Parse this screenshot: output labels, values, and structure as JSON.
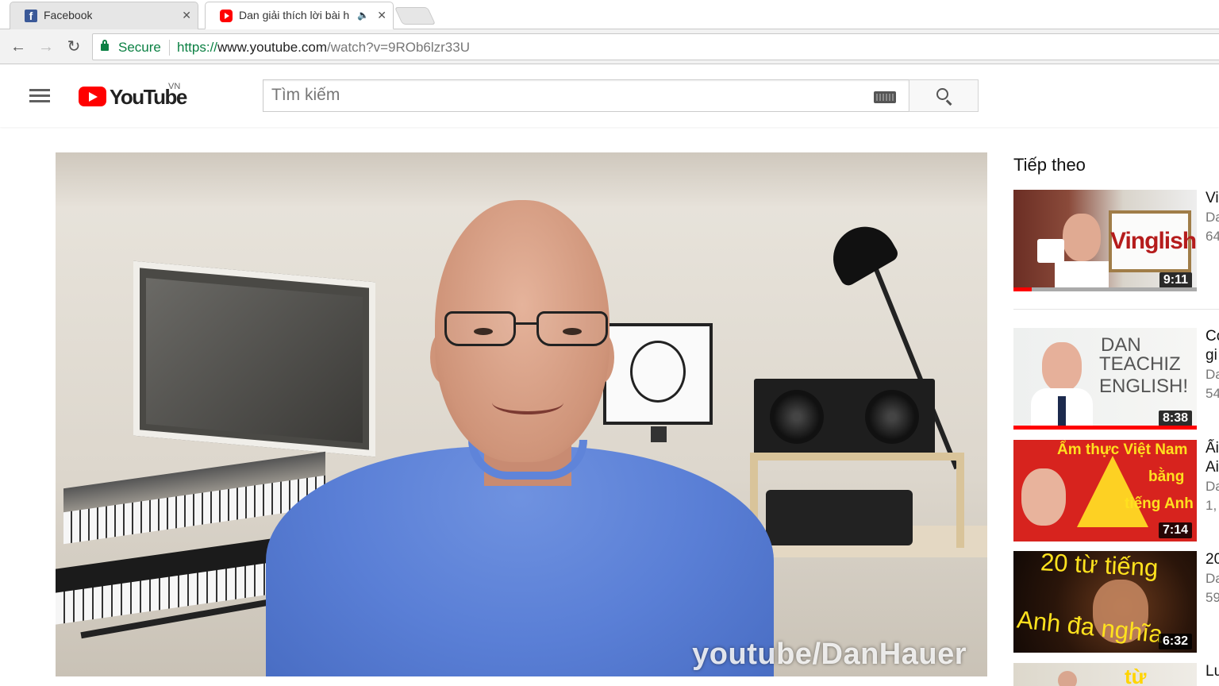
{
  "browser": {
    "tabs": [
      {
        "title": "Facebook",
        "favicon": "facebook-icon",
        "active": false
      },
      {
        "title": "Dan giải thích lời bài h",
        "favicon": "youtube-icon",
        "active": true,
        "audio": true
      }
    ],
    "secure_label": "Secure",
    "url_scheme": "https://",
    "url_host": "www.youtube.com",
    "url_path": "/watch?v=9ROb6lzr33U"
  },
  "masthead": {
    "logo_text": "YouTube",
    "region": "VN",
    "search_placeholder": "Tìm kiếm"
  },
  "player": {
    "watermark": "youtube/DanHauer"
  },
  "sidebar": {
    "heading": "Tiếp theo",
    "items": [
      {
        "duration": "9:11",
        "title": "Vi",
        "channel": "Da",
        "views": "64",
        "thumb_text": "Vinglish",
        "watched_fraction": 0.1
      },
      {
        "duration": "8:38",
        "title": "Co",
        "title2": "gi",
        "channel": "Da",
        "views": "54",
        "thumb_text": "DAN TEACHIZ ENGLISH!",
        "thumb_text_l1": "DAN",
        "thumb_text_l2": "TEACHIZ",
        "thumb_text_l3": "ENGLISH!",
        "watched_fraction": 1.0
      },
      {
        "duration": "7:14",
        "title": "Ẩi",
        "title2": "Ai",
        "channel": "Da",
        "views": "1,",
        "thumb_text_l1": "Ẩm thực Việt Nam",
        "thumb_text_l2": "bằng",
        "thumb_text_l3": "tiếng Anh"
      },
      {
        "duration": "6:32",
        "title": "20",
        "channel": "Da",
        "views": "59",
        "thumb_text_l1": "20 từ tiếng",
        "thumb_text_l2": "Anh đa nghĩa"
      },
      {
        "title": "Lu",
        "thumb_text_l1": "từ"
      }
    ]
  }
}
